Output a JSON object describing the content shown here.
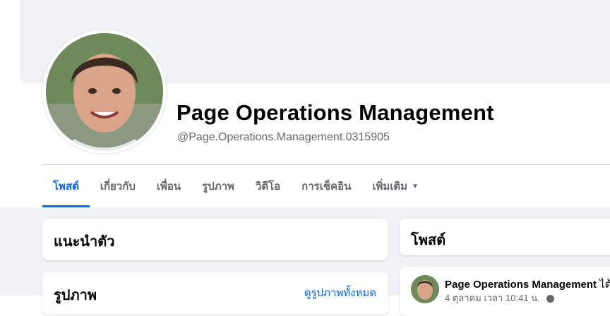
{
  "profile": {
    "name": "Page Operations Management",
    "handle": "@Page.Operations.Management.0315905"
  },
  "tabs": [
    {
      "label": "โพสต์"
    },
    {
      "label": "เกี่ยวกับ"
    },
    {
      "label": "เพื่อน"
    },
    {
      "label": "รูปภาพ"
    },
    {
      "label": "วิดีโอ"
    },
    {
      "label": "การเช็คอิน"
    },
    {
      "label": "เพิ่มเติม"
    }
  ],
  "intro": {
    "title": "แนะนำตัว"
  },
  "photos": {
    "title": "รูปภาพ",
    "see_all": "ดูรูปภาพทั้งหมด"
  },
  "posts": {
    "title": "โพสต์"
  },
  "post": {
    "author": "Page Operations Management",
    "action": "ได้อั",
    "time": "4 ตุลาคม เวลา 10:41 น."
  },
  "colors": {
    "accent": "#0866ff",
    "background": "#f0f2f5",
    "secondary_text": "#65676b"
  },
  "icons": {
    "more_caret": "caret-down-icon",
    "privacy": "globe-icon"
  }
}
